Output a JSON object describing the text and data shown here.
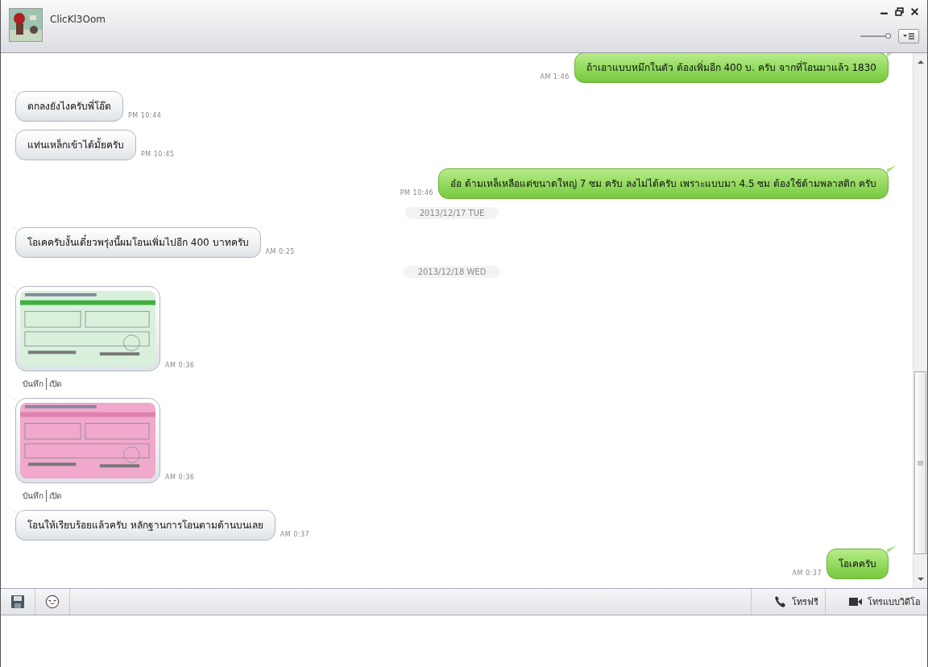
{
  "window": {
    "contact_name": "ClicKl3Oom",
    "zoom_slider": {
      "level": 0.92
    }
  },
  "messages": [
    {
      "kind": "text",
      "outgoing": true,
      "text": "ถ้าเอาแบบหมึกในตัว ต้องเพิ่มอีก 400 บ. ครับ จากที่โอนมาแล้ว 1830",
      "time": "AM 1:46"
    },
    {
      "kind": "text",
      "outgoing": false,
      "text": "ตกลงยังไงครับพี่โอ๊ต",
      "time": "PM 10:44"
    },
    {
      "kind": "text",
      "outgoing": false,
      "text": "แท่นเหล็กเข้าได้มั้ยครับ",
      "time": "PM 10:45"
    },
    {
      "kind": "text",
      "outgoing": true,
      "text": "อ๋อ ด้ามเหล็เหลือแต่ขนาดใหญ่ 7 ซม ครับ ลงไม่ได้ครับ เพราะแบบมา 4.5 ซม ต้องใช้ด้ามพลาสติก ครับ",
      "time": "PM 10:46"
    },
    {
      "kind": "date",
      "text": "2013/12/17 TUE"
    },
    {
      "kind": "text",
      "outgoing": false,
      "text": "โอเคครับงั้นเดี๋ยวพรุ่งนี้ผมโอนเพิ่มไปอีก 400 บาทครับ",
      "time": "AM 0:25"
    },
    {
      "kind": "date",
      "text": "2013/12/18 WED"
    },
    {
      "outgoing": false,
      "time": "AM 0:36",
      "actions": [
        "บันทึก",
        "เปิด"
      ]
    },
    {
      "outgoing": false,
      "time": "AM 0:36",
      "actions": [
        "บันทึก",
        "เปิด"
      ]
    },
    {
      "kind": "text",
      "outgoing": false,
      "text": "โอนให้เรียบร้อยแล้วครับ หลักฐานการโอนตามด้านบนเลย",
      "time": "AM 0:37"
    },
    {
      "kind": "text",
      "outgoing": true,
      "text": "โอเคครับ",
      "time": "AM 0:37"
    }
  ],
  "toolbar": {
    "call_label": "โทรฟรี",
    "video_call_label": "โทรแบบวิดีโอ"
  }
}
